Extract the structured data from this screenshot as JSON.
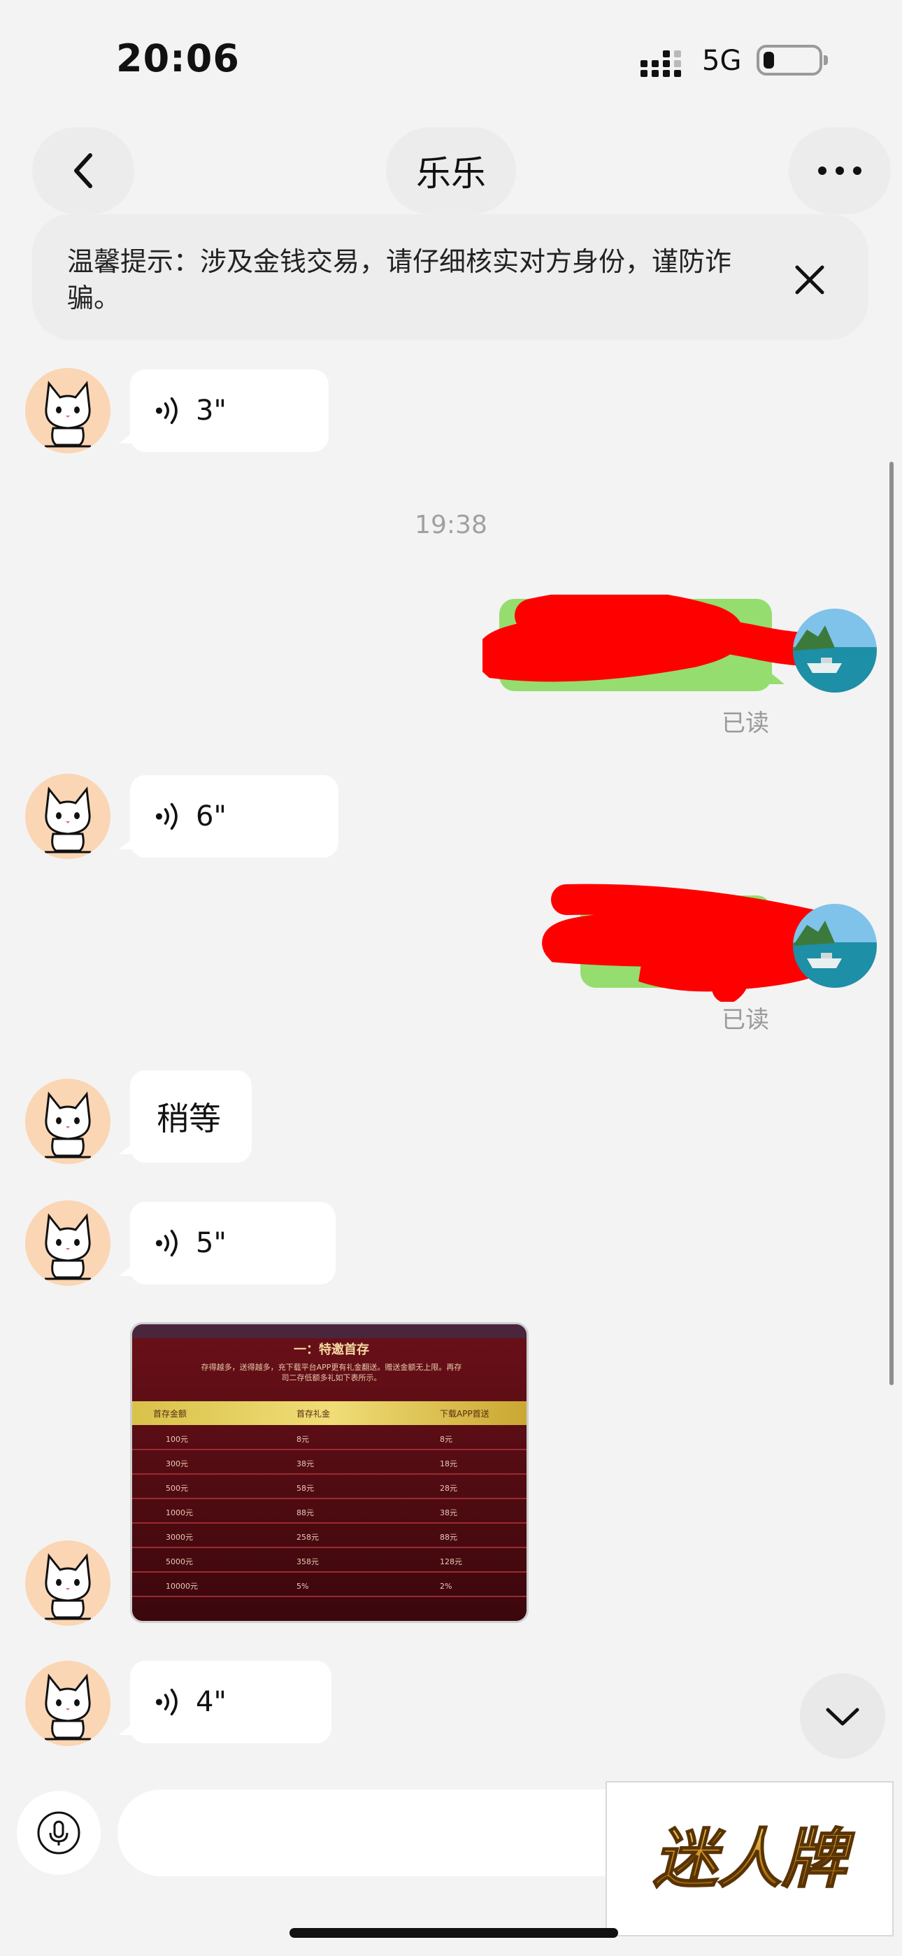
{
  "status_bar": {
    "time": "20:06",
    "network": "5G",
    "battery_level": 0.2
  },
  "header": {
    "title": "乐乐"
  },
  "notice": {
    "text": "温馨提示：涉及金钱交易，请仔细核实对方身份，谨防诈骗。"
  },
  "messages": {
    "voice1": {
      "duration": "3\""
    },
    "timestamp": "19:38",
    "read1": "已读",
    "voice2": {
      "duration": "6\""
    },
    "read2": "已读",
    "text1": "稍等",
    "voice3": {
      "duration": "5\""
    },
    "voice4": {
      "duration": "4\""
    }
  },
  "image_table": {
    "title": "一：特邀首存",
    "note": "存得越多，送得越多，充下载平台APP更有礼金翻送。赠送金额无上限。再存司二存低额多礼如下表所示。",
    "headers": [
      "首存金额",
      "首存礼金",
      "下载APP首送"
    ],
    "rows": [
      [
        "100元",
        "8元",
        "8元"
      ],
      [
        "300元",
        "38元",
        "18元"
      ],
      [
        "500元",
        "58元",
        "28元"
      ],
      [
        "1000元",
        "88元",
        "38元"
      ],
      [
        "3000元",
        "258元",
        "88元"
      ],
      [
        "5000元",
        "358元",
        "128元"
      ],
      [
        "10000元",
        "5%",
        "2%"
      ]
    ]
  },
  "watermark": {
    "text": "迷人牌"
  },
  "colors": {
    "accent_green": "#95dd6f",
    "avatar_bg": "#fbd6b4",
    "background": "#f3f3f3"
  },
  "icons": [
    "back-arrow-icon",
    "more-icon",
    "close-icon",
    "voice-wave-icon",
    "chevron-down-icon",
    "microphone-icon",
    "signal-icon",
    "battery-icon"
  ]
}
